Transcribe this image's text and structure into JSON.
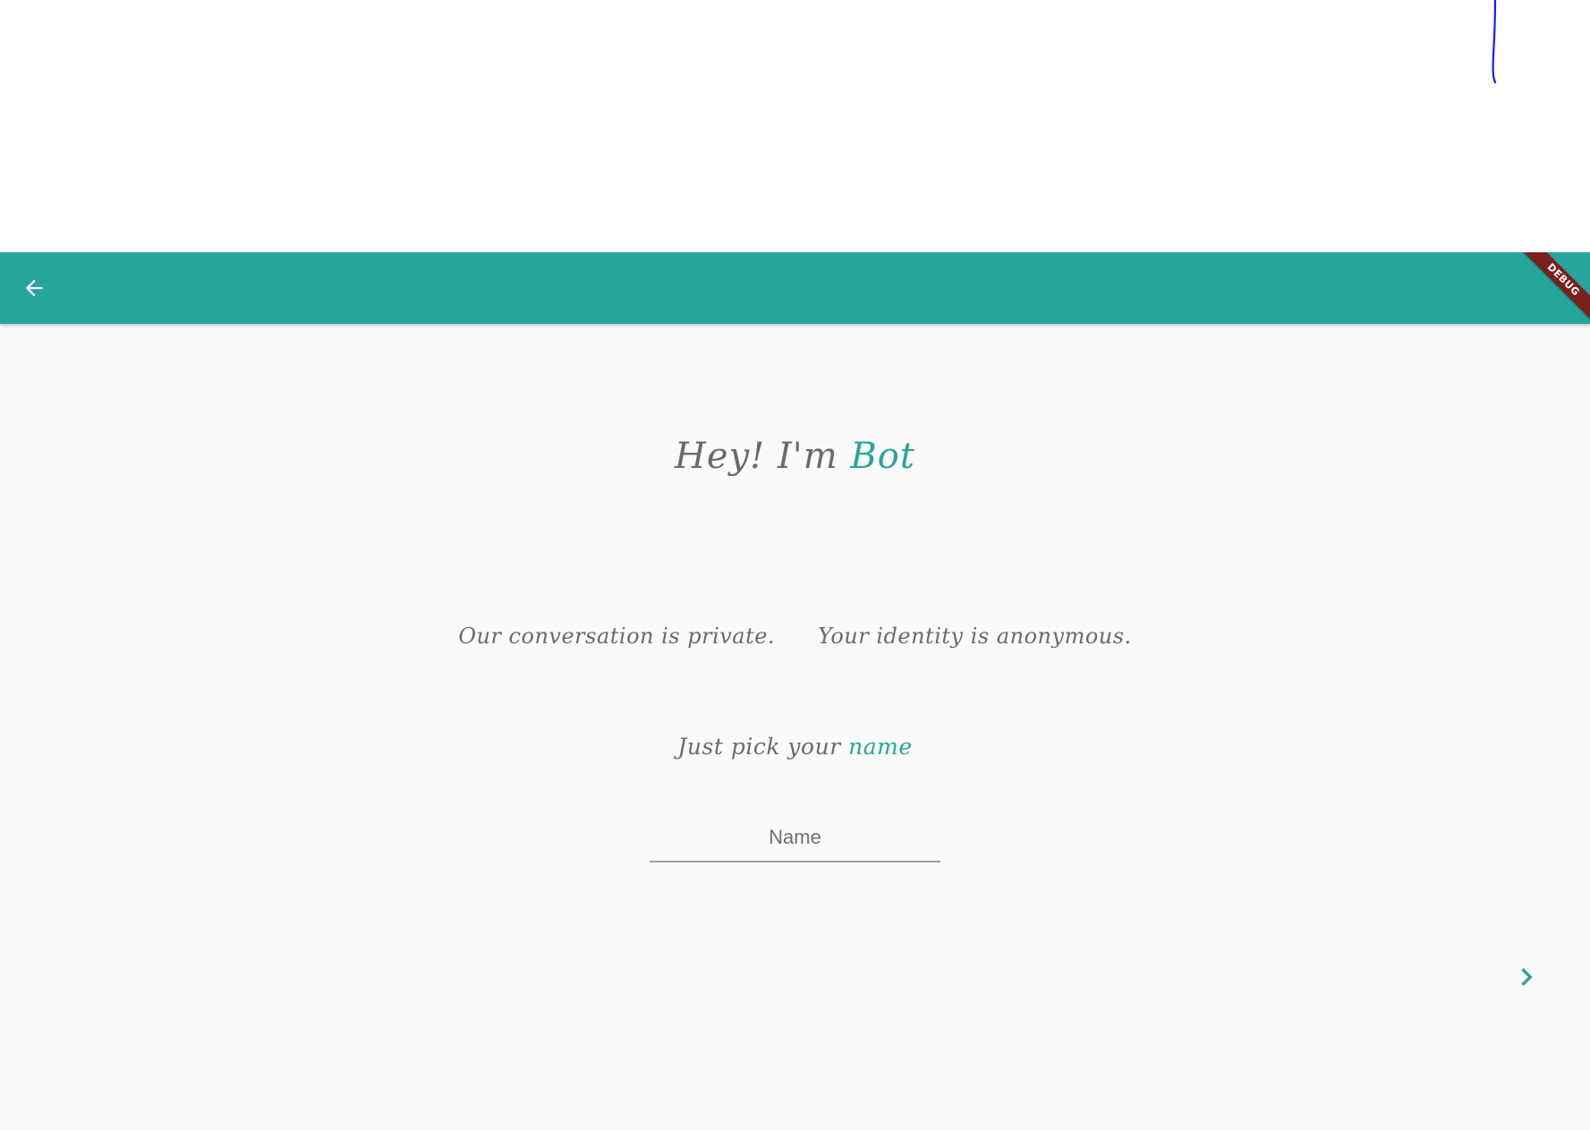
{
  "colors": {
    "accent": "#26a69a",
    "app_bar": "#26a69a",
    "body_text": "#6a6a6a",
    "background": "#fafafa",
    "debug_ribbon": "#7b1f1f",
    "pen_stroke": "#1a1aff"
  },
  "app_bar": {
    "back_icon": "arrow-back-icon",
    "debug_label": "DEBUG"
  },
  "greeting": {
    "prefix": "Hey! I'm",
    "bot_name": "Bot"
  },
  "privacy": {
    "private_text": "Our conversation is private.",
    "anonymous_text": "Your identity is anonymous."
  },
  "name_prompt": {
    "prefix": "Just pick your",
    "highlight": "name"
  },
  "name_input": {
    "value": "",
    "placeholder": "Name"
  },
  "next_button": {
    "icon": "chevron-right-icon"
  }
}
